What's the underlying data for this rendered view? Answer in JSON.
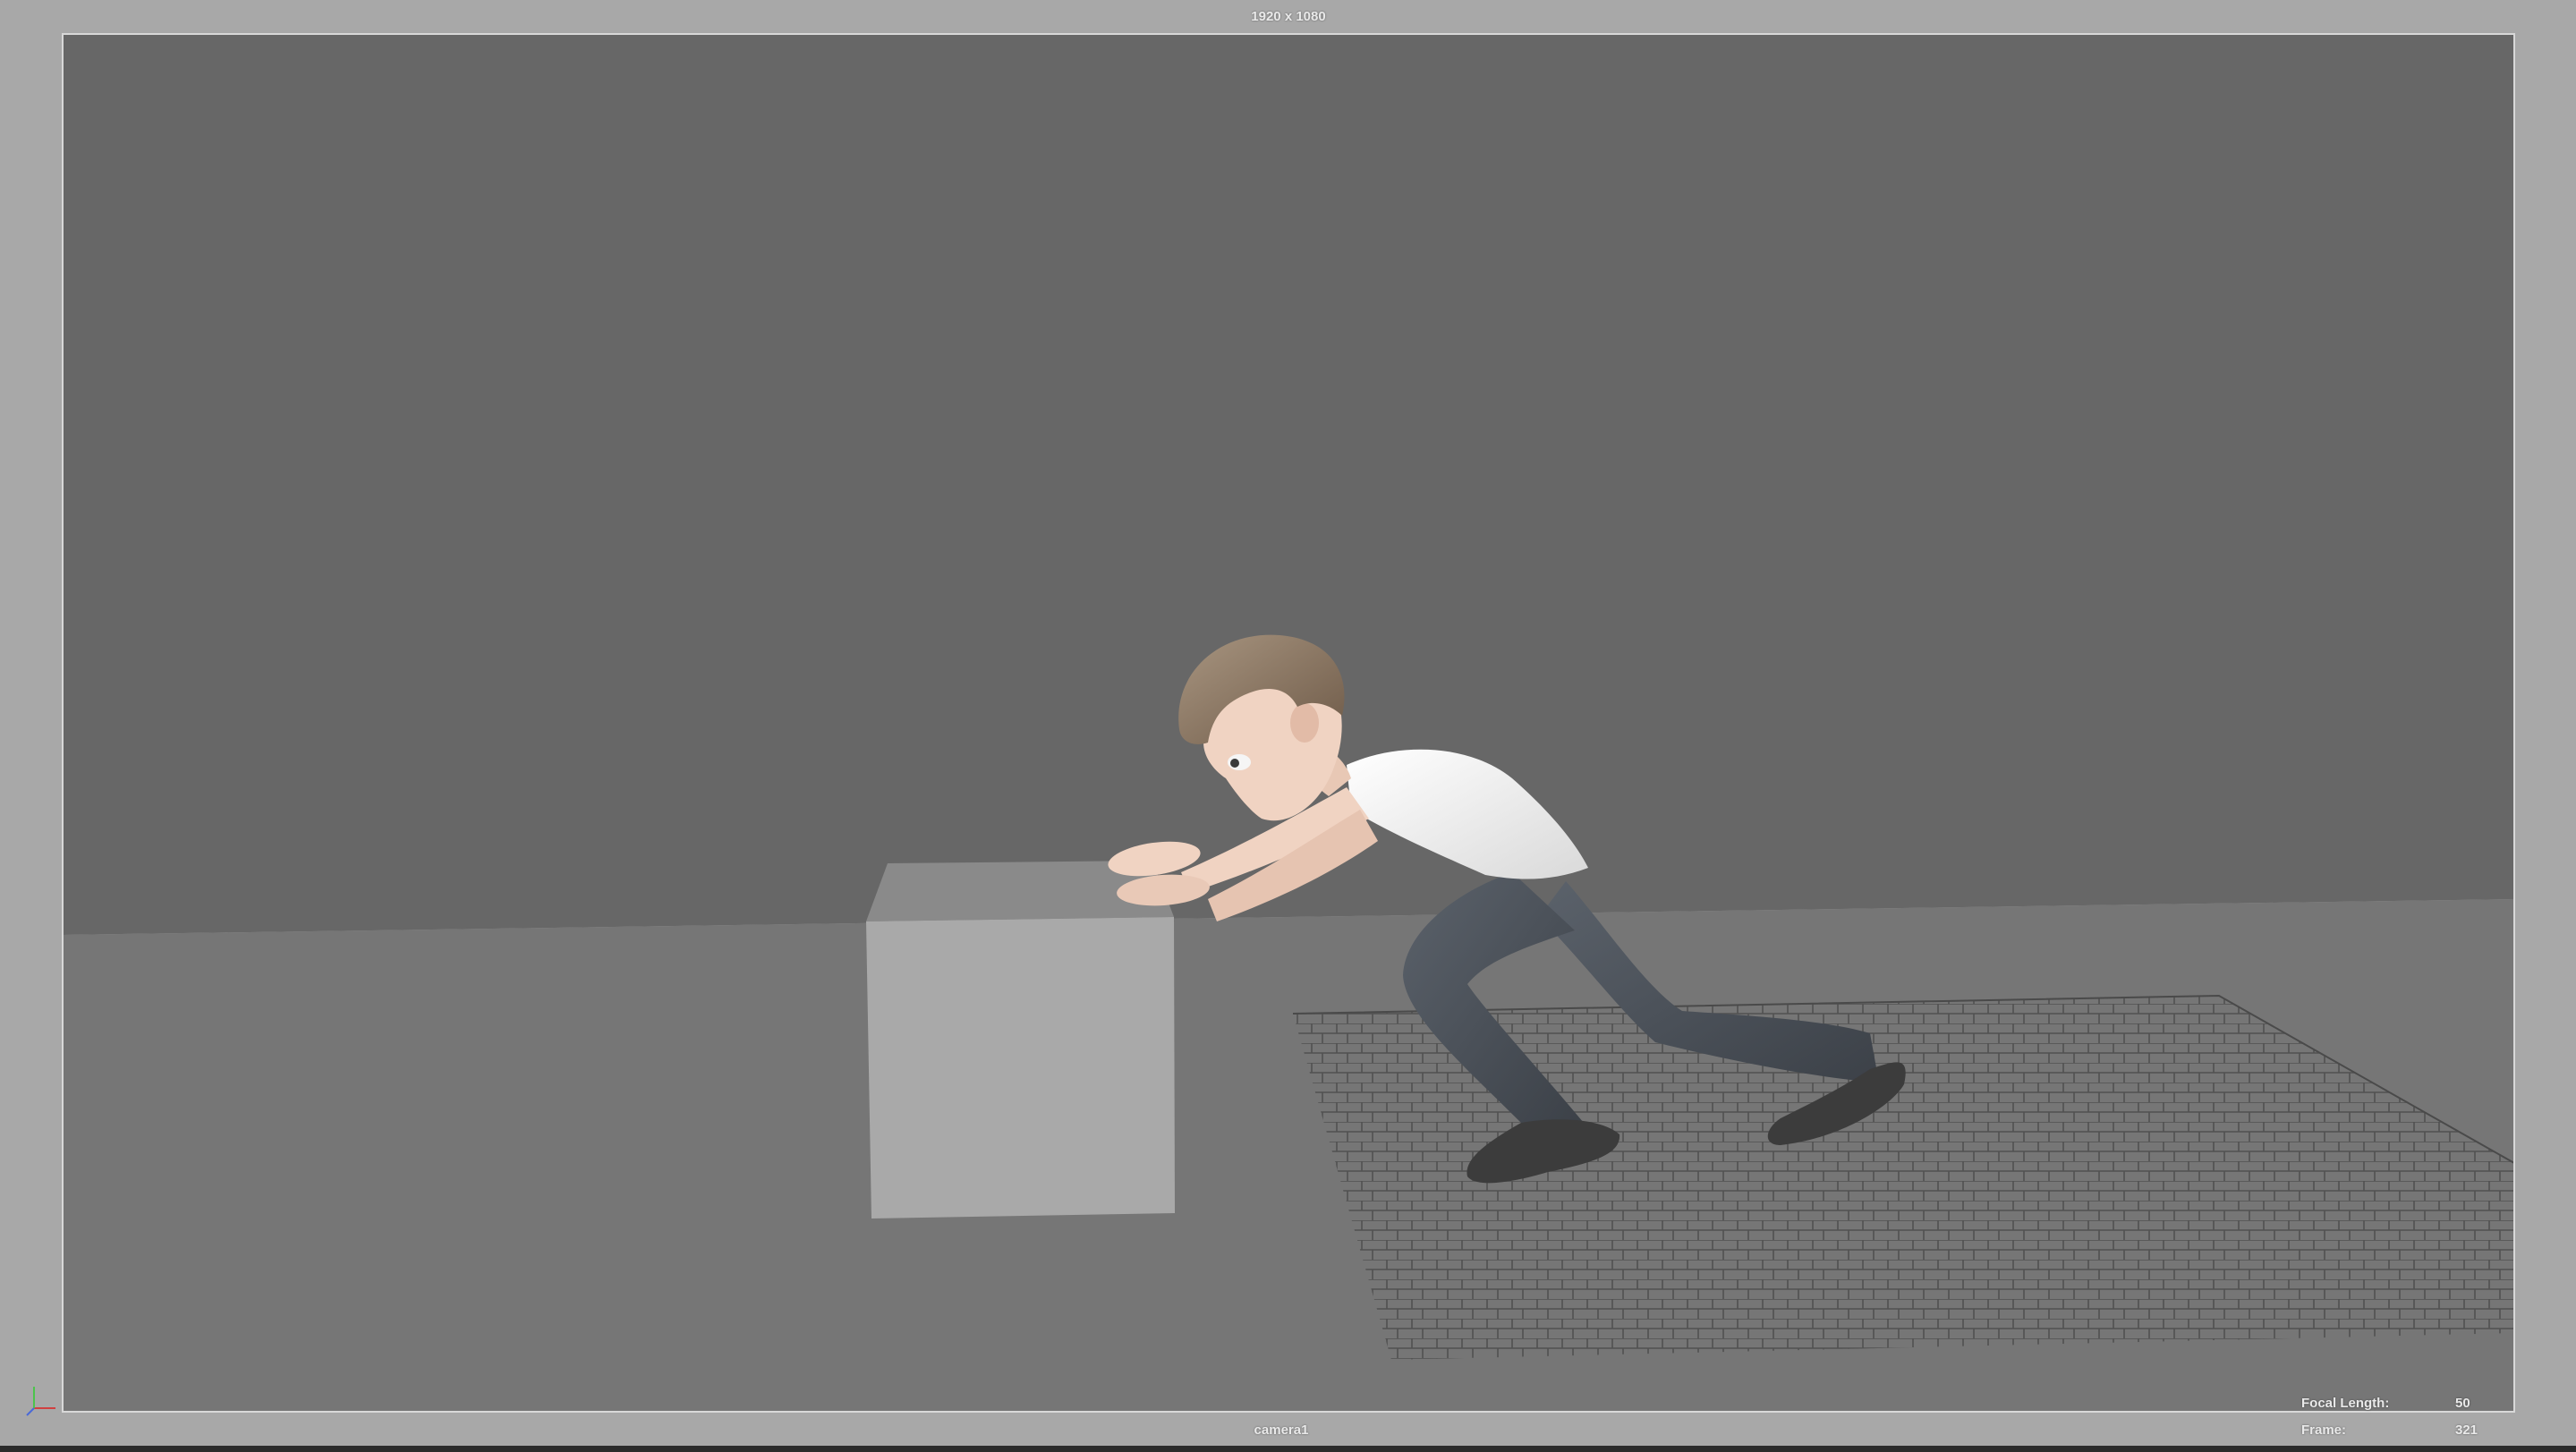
{
  "viewport": {
    "resolution_gate": "1920 x 1080",
    "camera_name": "camera1",
    "hud": {
      "focal_length_label": "Focal Length:",
      "focal_length_value": "50",
      "frame_label": "Frame:",
      "frame_value": "321"
    }
  },
  "colors": {
    "viewport_background": "#a8a8a8",
    "backdrop_wall": "#676767",
    "floor": "#767676",
    "box": "#a9a9a9",
    "grid_lines": "#4a4a4a",
    "shirt": "#f2f2f2",
    "pants": "#4b5159",
    "skin": "#f0d3c2",
    "hair": "#8a735f",
    "shoes": "#3c3c3c"
  },
  "icons": {
    "axis": "xyz-axis-icon"
  }
}
